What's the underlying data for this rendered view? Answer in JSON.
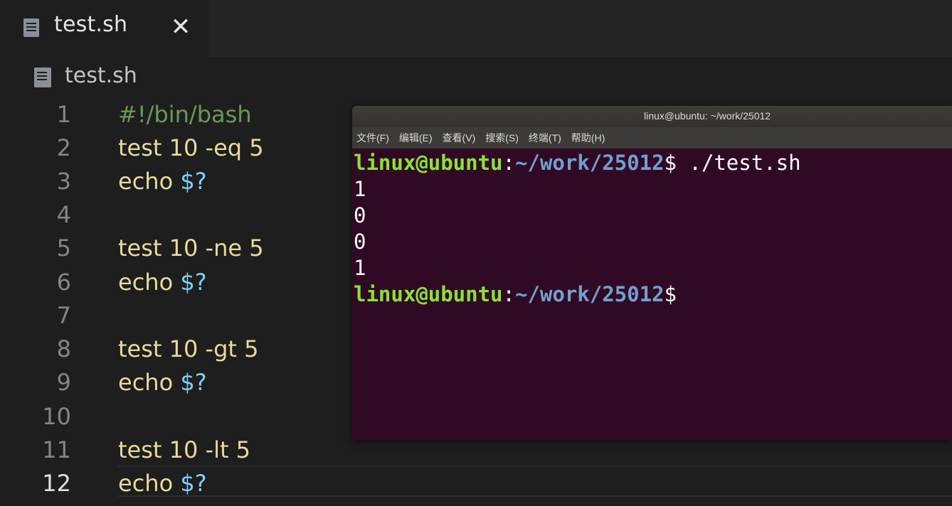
{
  "editor": {
    "tab": {
      "label": "test.sh",
      "close_glyph": "✕"
    },
    "breadcrumb": {
      "label": "test.sh"
    },
    "lines": [
      {
        "number": "1",
        "parts": [
          {
            "text": "#!/bin/bash",
            "kind": "comment"
          }
        ]
      },
      {
        "number": "2",
        "parts": [
          {
            "text": "test 10 -eq 5",
            "kind": "plain"
          }
        ]
      },
      {
        "number": "3",
        "parts": [
          {
            "text": "echo ",
            "kind": "plain"
          },
          {
            "text": "$?",
            "kind": "var"
          }
        ]
      },
      {
        "number": "4",
        "parts": []
      },
      {
        "number": "5",
        "parts": [
          {
            "text": "test 10 -ne 5",
            "kind": "plain"
          }
        ]
      },
      {
        "number": "6",
        "parts": [
          {
            "text": "echo ",
            "kind": "plain"
          },
          {
            "text": "$?",
            "kind": "var"
          }
        ]
      },
      {
        "number": "7",
        "parts": []
      },
      {
        "number": "8",
        "parts": [
          {
            "text": "test 10 -gt 5",
            "kind": "plain"
          }
        ]
      },
      {
        "number": "9",
        "parts": [
          {
            "text": "echo ",
            "kind": "plain"
          },
          {
            "text": "$?",
            "kind": "var"
          }
        ]
      },
      {
        "number": "10",
        "parts": []
      },
      {
        "number": "11",
        "parts": [
          {
            "text": "test 10 -lt 5",
            "kind": "plain"
          }
        ]
      },
      {
        "number": "12",
        "parts": [
          {
            "text": "echo ",
            "kind": "plain"
          },
          {
            "text": "$?",
            "kind": "var"
          }
        ],
        "active": true
      }
    ]
  },
  "terminal": {
    "title": "linux@ubuntu: ~/work/25012",
    "menu": [
      "文件(F)",
      "编辑(E)",
      "查看(V)",
      "搜索(S)",
      "终端(T)",
      "帮助(H)"
    ],
    "prompt": {
      "user": "linux@ubuntu",
      "sep": ":",
      "path": "~/work/25012",
      "symbol": "$"
    },
    "command": " ./test.sh",
    "output": [
      "1",
      "0",
      "0",
      "1"
    ]
  },
  "colors": {
    "editor_bg": "#1e1e1e",
    "terminal_bg": "#300a24",
    "prompt_user": "#8ae234",
    "prompt_path": "#729fcf",
    "code_text": "#e6db9b",
    "code_var": "#7fd0f5",
    "code_comment": "#6a9955"
  }
}
